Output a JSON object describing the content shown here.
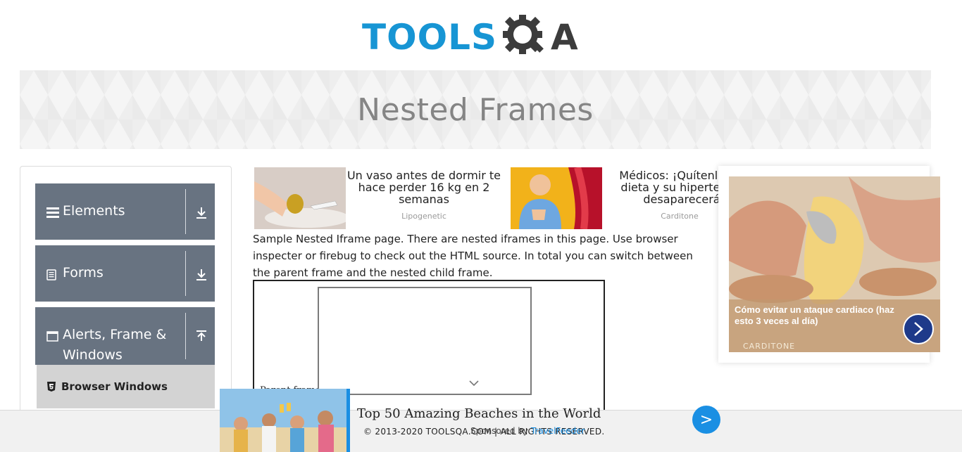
{
  "logo": {
    "part1": "TOOLS",
    "part2": "A"
  },
  "banner": {
    "title": "Nested Frames"
  },
  "sidebar": {
    "groups": [
      {
        "label": "Elements",
        "icon": "hamburger-icon",
        "arrow": "download-icon"
      },
      {
        "label": "Forms",
        "icon": "document-icon",
        "arrow": "download-icon"
      },
      {
        "label_line1": "Alerts, Frame &",
        "label_line2": "Windows",
        "icon": "window-icon",
        "arrow": "upload-icon"
      }
    ],
    "active_item": {
      "label": "Browser Windows",
      "icon": "html5-icon"
    }
  },
  "content_ads": [
    {
      "title_l1": "Un vaso antes de dormir te",
      "title_l2": "hace perder 16 kg en 2",
      "title_l3": "semanas",
      "source": "Lipogenetic"
    },
    {
      "title_l1": "Médicos: ¡Quítenlo",
      "title_l2": "dieta y su hiperter",
      "title_l3": "desaparecerá!",
      "source": "Carditone"
    }
  ],
  "description": "Sample Nested Iframe page. There are nested iframes in this page. Use browser inspecter or firebug to check out the HTML source. In total you can switch between the parent frame and the nested child frame.",
  "frame": {
    "parent_label": "Parent frame"
  },
  "right_ad": {
    "caption": "Cómo evitar un ataque cardiaco (haz esto 3 veces al día)",
    "brand": "CARDITONE"
  },
  "bottom_ad": {
    "title": "Top 50 Amazing Beaches in the World",
    "sponsor_prefix": "Sponsored by",
    "sponsor_name": "TravelFeeder",
    "button": ">"
  },
  "footer": {
    "copyright": "© 2013-2020 TOOLSQA.COM | ALL RIGHTS RESERVED."
  },
  "colors": {
    "brand_blue": "#1795d4",
    "sidebar_bg": "#687381",
    "ad_button": "#1a8fe3"
  }
}
